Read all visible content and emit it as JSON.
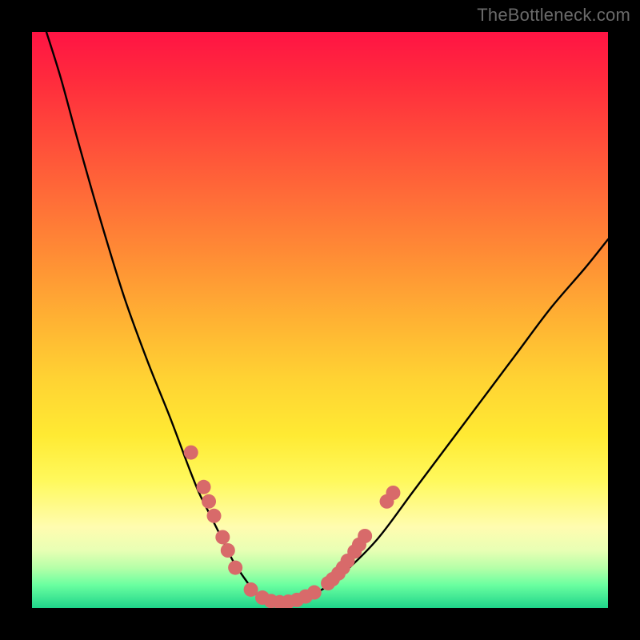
{
  "watermark": "TheBottleneck.com",
  "chart_data": {
    "type": "line",
    "title": "",
    "xlabel": "",
    "ylabel": "",
    "xlim": [
      0,
      100
    ],
    "ylim": [
      0,
      100
    ],
    "grid": false,
    "series": [
      {
        "name": "bottleneck-curve",
        "color": "#000000",
        "x_values_are_percent_of_plot_width": true,
        "y_values_are_percent_of_plot_height_from_bottom": true,
        "x": [
          2.5,
          5,
          8,
          12,
          16,
          20,
          24,
          27,
          29,
          31,
          33,
          35,
          37,
          38.5,
          40,
          43,
          46,
          50,
          54,
          60,
          66,
          72,
          78,
          84,
          90,
          96,
          100
        ],
        "y": [
          100,
          92,
          81,
          67,
          54,
          43,
          33,
          25,
          20,
          16,
          12,
          8,
          5,
          3,
          1.5,
          1,
          1.5,
          3,
          6,
          12,
          20,
          28,
          36,
          44,
          52,
          59,
          64
        ]
      }
    ],
    "scatter": {
      "name": "sample-points",
      "color": "#d86a6a",
      "radius_px": 9,
      "x_values_are_percent_of_plot_width": true,
      "y_values_are_percent_of_plot_height_from_bottom": true,
      "points": [
        {
          "x": 27.6,
          "y": 27
        },
        {
          "x": 29.8,
          "y": 21
        },
        {
          "x": 30.7,
          "y": 18.5
        },
        {
          "x": 31.6,
          "y": 16
        },
        {
          "x": 33.1,
          "y": 12.3
        },
        {
          "x": 34.0,
          "y": 10
        },
        {
          "x": 35.3,
          "y": 7
        },
        {
          "x": 38.0,
          "y": 3.2
        },
        {
          "x": 40.0,
          "y": 1.8
        },
        {
          "x": 41.5,
          "y": 1.2
        },
        {
          "x": 43.0,
          "y": 1.0
        },
        {
          "x": 44.5,
          "y": 1.1
        },
        {
          "x": 46.0,
          "y": 1.4
        },
        {
          "x": 47.5,
          "y": 2.0
        },
        {
          "x": 49.0,
          "y": 2.7
        },
        {
          "x": 51.4,
          "y": 4.3
        },
        {
          "x": 52.2,
          "y": 5.0
        },
        {
          "x": 53.2,
          "y": 6.0
        },
        {
          "x": 54.0,
          "y": 7.0
        },
        {
          "x": 54.8,
          "y": 8.2
        },
        {
          "x": 56.0,
          "y": 9.8
        },
        {
          "x": 56.8,
          "y": 11
        },
        {
          "x": 57.8,
          "y": 12.5
        },
        {
          "x": 61.6,
          "y": 18.5
        },
        {
          "x": 62.7,
          "y": 20.0
        }
      ]
    },
    "gradient_stops_top_to_bottom": [
      {
        "pos": 0.0,
        "color": "#ff1444"
      },
      {
        "pos": 0.18,
        "color": "#ff4a3a"
      },
      {
        "pos": 0.38,
        "color": "#ff8a35"
      },
      {
        "pos": 0.6,
        "color": "#ffd233"
      },
      {
        "pos": 0.78,
        "color": "#fff95d"
      },
      {
        "pos": 0.9,
        "color": "#e8ffb4"
      },
      {
        "pos": 1.0,
        "color": "#1fd48a"
      }
    ]
  }
}
